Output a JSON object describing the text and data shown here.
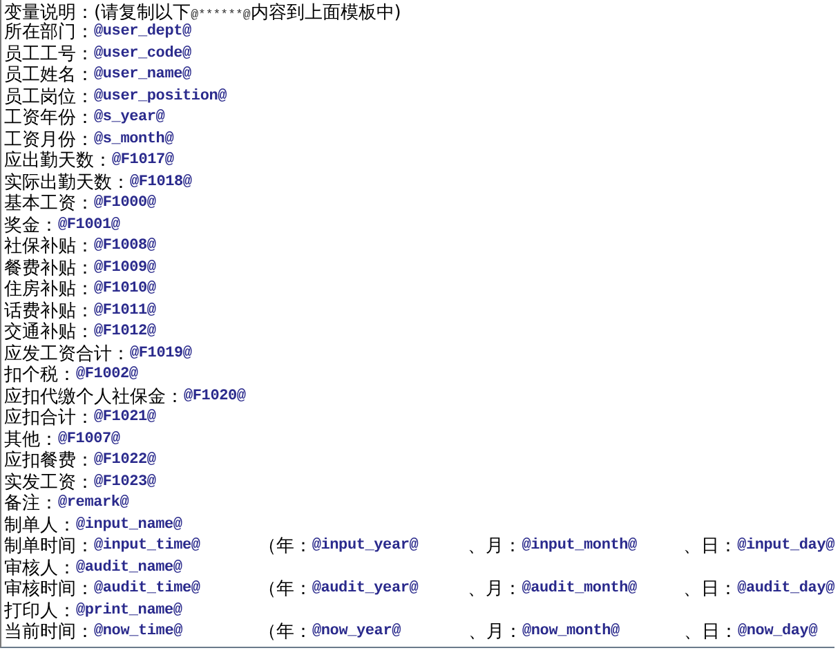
{
  "header": {
    "label": "变量说明：",
    "note": "(请复制以下",
    "code": "@******@",
    "note_end": "内容到上面模板中)"
  },
  "lines": [
    {
      "label": "所在部门：",
      "value": "@user_dept@"
    },
    {
      "label": "员工工号：",
      "value": "@user_code@"
    },
    {
      "label": "员工姓名：",
      "value": "@user_name@"
    },
    {
      "label": "员工岗位：",
      "value": "@user_position@"
    },
    {
      "label": "工资年份：",
      "value": "@s_year@"
    },
    {
      "label": "工资月份：",
      "value": "@s_month@"
    },
    {
      "label": "应出勤天数：",
      "value": "@F1017@"
    },
    {
      "label": "实际出勤天数：",
      "value": "@F1018@"
    },
    {
      "label": "基本工资：",
      "value": "@F1000@"
    },
    {
      "label": "奖金：",
      "value": "@F1001@"
    },
    {
      "label": "社保补贴：",
      "value": "@F1008@"
    },
    {
      "label": "餐费补贴：",
      "value": "@F1009@"
    },
    {
      "label": "住房补贴：",
      "value": "@F1010@"
    },
    {
      "label": "话费补贴：",
      "value": "@F1011@"
    },
    {
      "label": "交通补贴：",
      "value": "@F1012@"
    },
    {
      "label": "应发工资合计：",
      "value": "@F1019@"
    },
    {
      "label": "扣个税：",
      "value": "@F1002@"
    },
    {
      "label": "应扣代缴个人社保金：",
      "value": "@F1020@"
    },
    {
      "label": "应扣合计：",
      "value": "@F1021@"
    },
    {
      "label": "其他：",
      "value": "@F1007@"
    },
    {
      "label": "应扣餐费：",
      "value": "@F1022@"
    },
    {
      "label": "实发工资：",
      "value": "@F1023@"
    },
    {
      "label": "备注：",
      "value": "@remark@"
    },
    {
      "label": "制单人：",
      "value": "@input_name@"
    },
    {
      "label": "制单时间：",
      "value": "@input_time@",
      "parts": [
        {
          "label": "（年：",
          "value": "@input_year@"
        },
        {
          "label": "、月：",
          "value": "@input_month@"
        },
        {
          "label": "、日：",
          "value": "@input_day@"
        }
      ]
    },
    {
      "label": "审核人：",
      "value": "@audit_name@"
    },
    {
      "label": "审核时间：",
      "value": "@audit_time@",
      "parts": [
        {
          "label": "（年：",
          "value": "@audit_year@"
        },
        {
          "label": "、月：",
          "value": "@audit_month@"
        },
        {
          "label": "、日：",
          "value": "@audit_day@"
        }
      ]
    },
    {
      "label": "打印人：",
      "value": "@print_name@"
    },
    {
      "label": "当前时间：",
      "value": "@now_time@",
      "parts": [
        {
          "label": "（年：",
          "value": "@now_year@"
        },
        {
          "label": "、月：",
          "value": "@now_month@"
        },
        {
          "label": "、日：",
          "value": "@now_day@"
        }
      ]
    }
  ]
}
